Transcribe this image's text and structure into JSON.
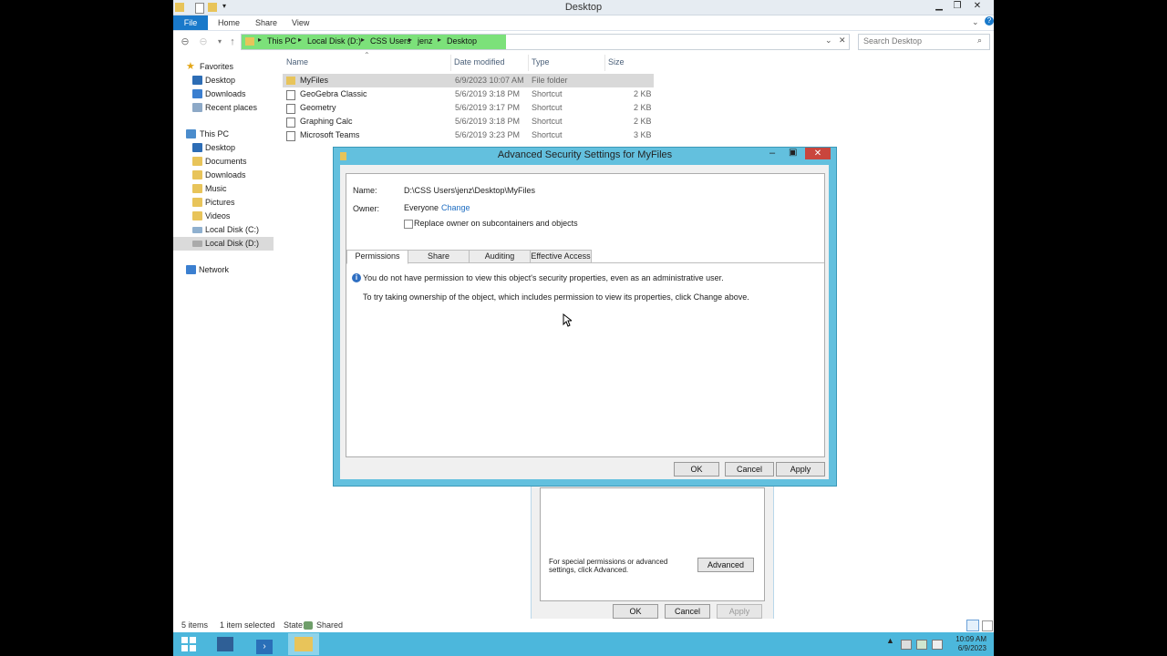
{
  "window": {
    "title": "Desktop"
  },
  "ribbon": {
    "tabs": [
      "File",
      "Home",
      "Share",
      "View"
    ]
  },
  "address": {
    "crumbs": [
      "This PC",
      "Local Disk (D:)",
      "CSS Users",
      "jenz",
      "Desktop"
    ],
    "search_placeholder": "Search Desktop"
  },
  "nav": {
    "favorites": "Favorites",
    "fav_items": [
      "Desktop",
      "Downloads",
      "Recent places"
    ],
    "thispc": "This PC",
    "pc_items": [
      "Desktop",
      "Documents",
      "Downloads",
      "Music",
      "Pictures",
      "Videos",
      "Local Disk (C:)",
      "Local Disk (D:)"
    ],
    "network": "Network"
  },
  "files": {
    "columns": [
      "Name",
      "Date modified",
      "Type",
      "Size"
    ],
    "rows": [
      {
        "name": "MyFiles",
        "date": "6/9/2023 10:07 AM",
        "type": "File folder",
        "size": ""
      },
      {
        "name": "GeoGebra Classic",
        "date": "5/6/2019 3:18 PM",
        "type": "Shortcut",
        "size": "2 KB"
      },
      {
        "name": "Geometry",
        "date": "5/6/2019 3:17 PM",
        "type": "Shortcut",
        "size": "2 KB"
      },
      {
        "name": "Graphing Calc",
        "date": "5/6/2019 3:18 PM",
        "type": "Shortcut",
        "size": "2 KB"
      },
      {
        "name": "Microsoft Teams",
        "date": "5/6/2019 3:23 PM",
        "type": "Shortcut",
        "size": "3 KB"
      }
    ]
  },
  "status": {
    "items": "5 items",
    "selected": "1 item selected",
    "state_label": "State:",
    "state_value": "Shared"
  },
  "props_dialog": {
    "special_text": "For special permissions or advanced settings, click Advanced.",
    "advanced": "Advanced",
    "ok": "OK",
    "cancel": "Cancel",
    "apply": "Apply"
  },
  "adv_dialog": {
    "title": "Advanced Security Settings for MyFiles",
    "name_label": "Name:",
    "name_value": "D:\\CSS Users\\jenz\\Desktop\\MyFiles",
    "owner_label": "Owner:",
    "owner_value": "Everyone",
    "change_link": "Change",
    "replace_owner": "Replace owner on subcontainers and objects",
    "tabs": [
      "Permissions",
      "Share",
      "Auditing",
      "Effective Access"
    ],
    "message1": "You do not have permission to view this object's security properties, even as an administrative user.",
    "message2": "To try taking ownership of the object, which includes permission to view its properties, click Change above.",
    "ok": "OK",
    "cancel": "Cancel",
    "apply": "Apply"
  },
  "clock": {
    "time": "10:09 AM",
    "date": "6/9/2023"
  },
  "colors": {
    "accent": "#1979ca",
    "address_fill": "#7ce17a",
    "dialog_frame": "#63c0de",
    "taskbar": "#4cb7dc"
  }
}
